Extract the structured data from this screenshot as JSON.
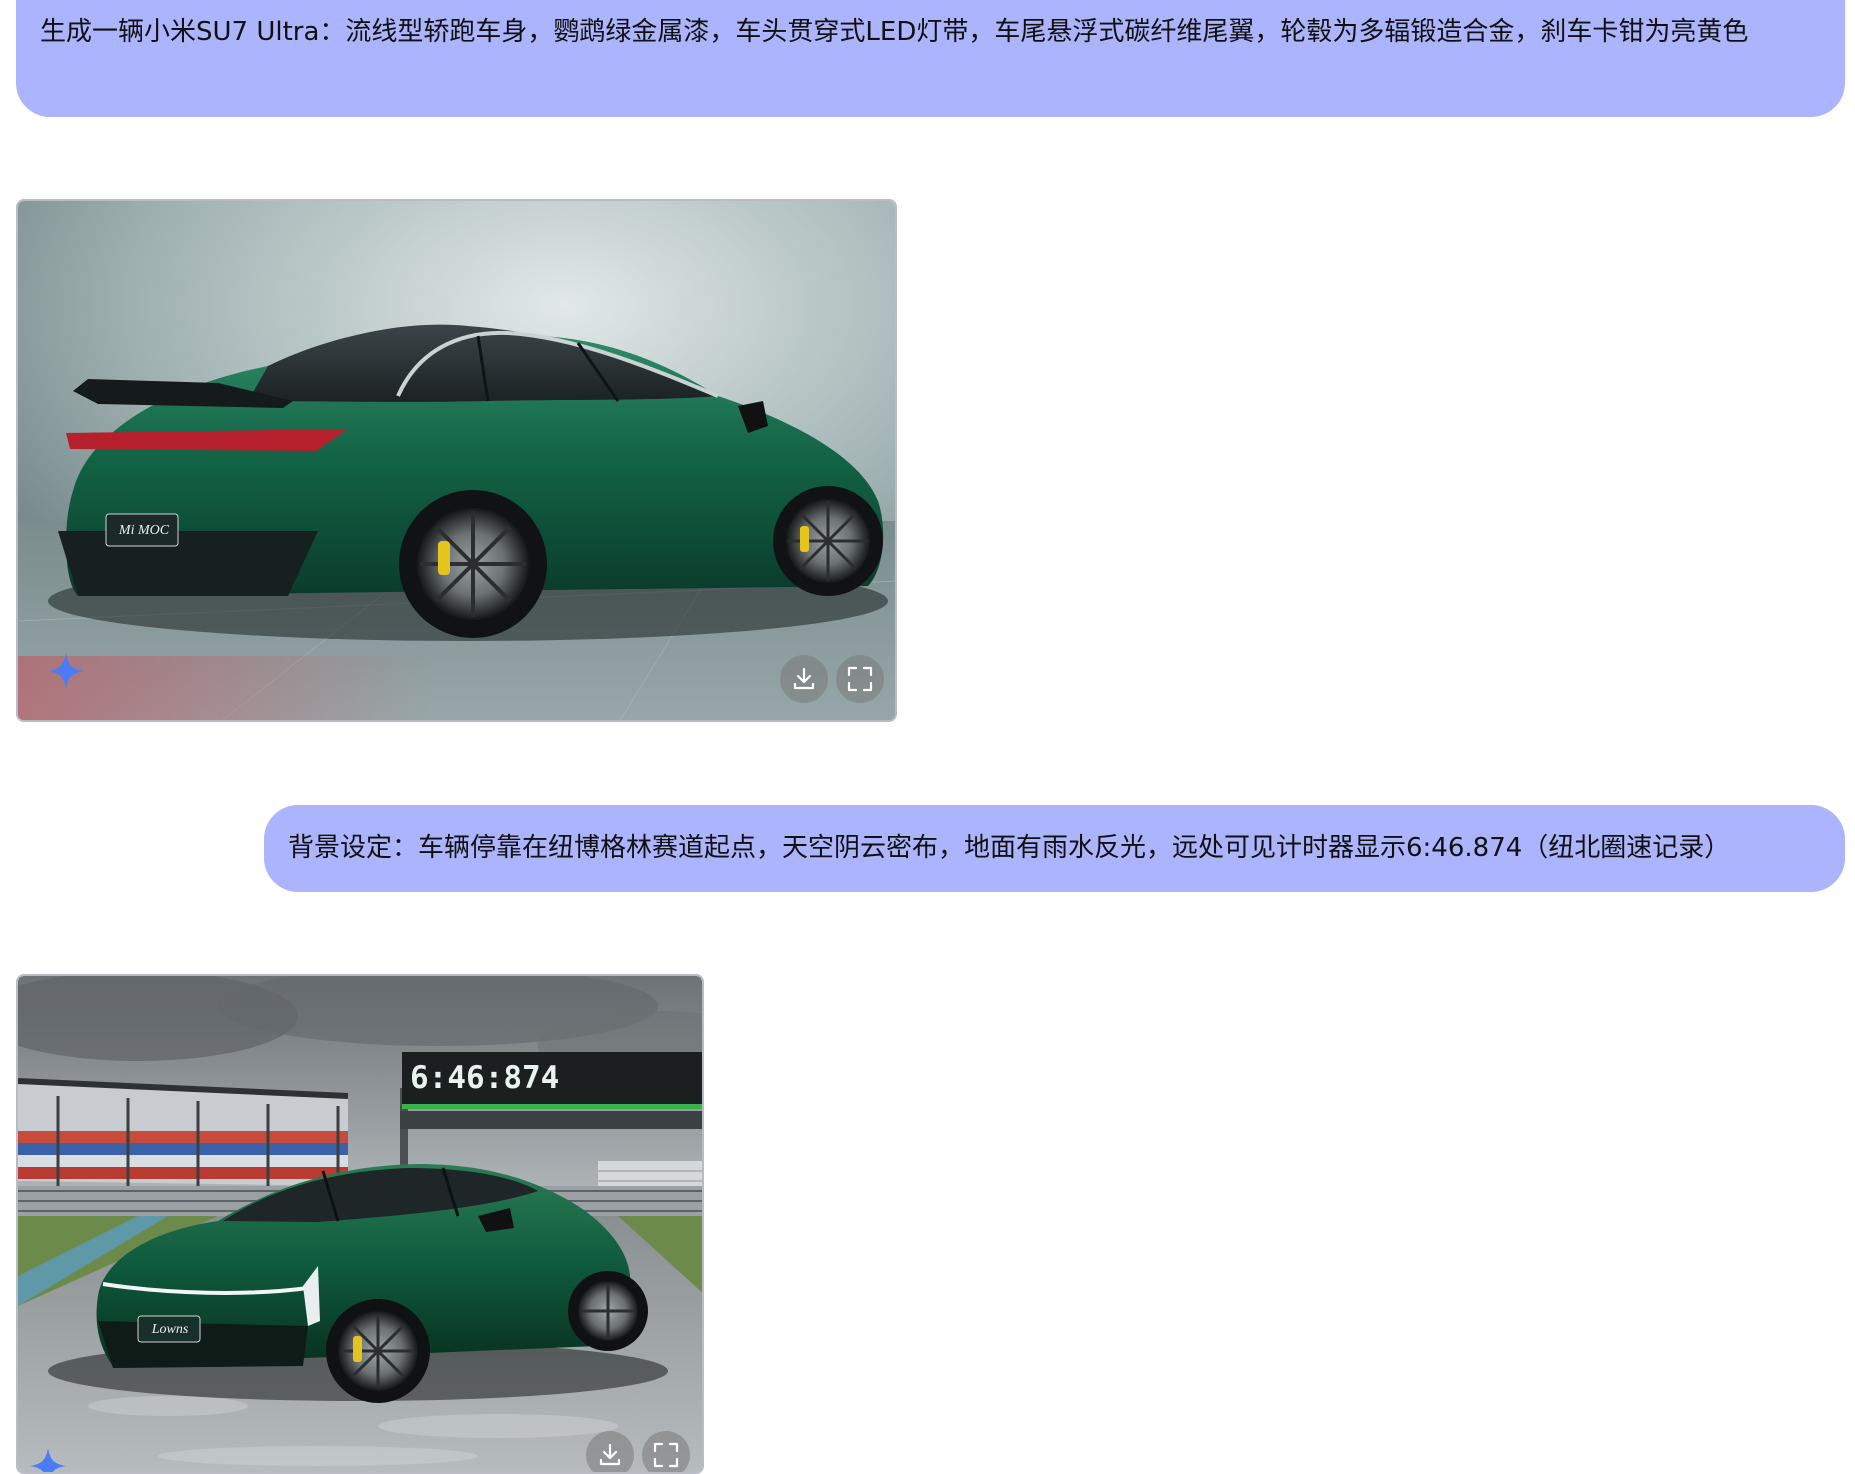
{
  "messages": [
    {
      "role": "user",
      "text": "生成一辆小米SU7 Ultra：流线型轿跑车身，鹦鹉绿金属漆，车头贯穿式LED灯带，车尾悬浮式碳纤维尾翼，轮毂为多辐锻造合金，刹车卡钳为亮黄色"
    },
    {
      "role": "user",
      "text": "背景设定：车辆停靠在纽博格林赛道起点，天空阴云密布，地面有雨水反光，远处可见计时器显示6:46.874（纽北圈速记录）"
    }
  ],
  "images": [
    {
      "plate_text": "Mi MOC",
      "actions": {
        "download_icon": "download-icon",
        "fullscreen_icon": "fullscreen-icon"
      }
    },
    {
      "timer_text": "6:46:874",
      "plate_text": "Lowns",
      "actions": {
        "download_icon": "download-icon",
        "fullscreen_icon": "fullscreen-icon"
      }
    }
  ],
  "colors": {
    "bubble": "#abb4fc",
    "car_green": "#0f5a3e",
    "sparkle": "#4a7cf5"
  }
}
